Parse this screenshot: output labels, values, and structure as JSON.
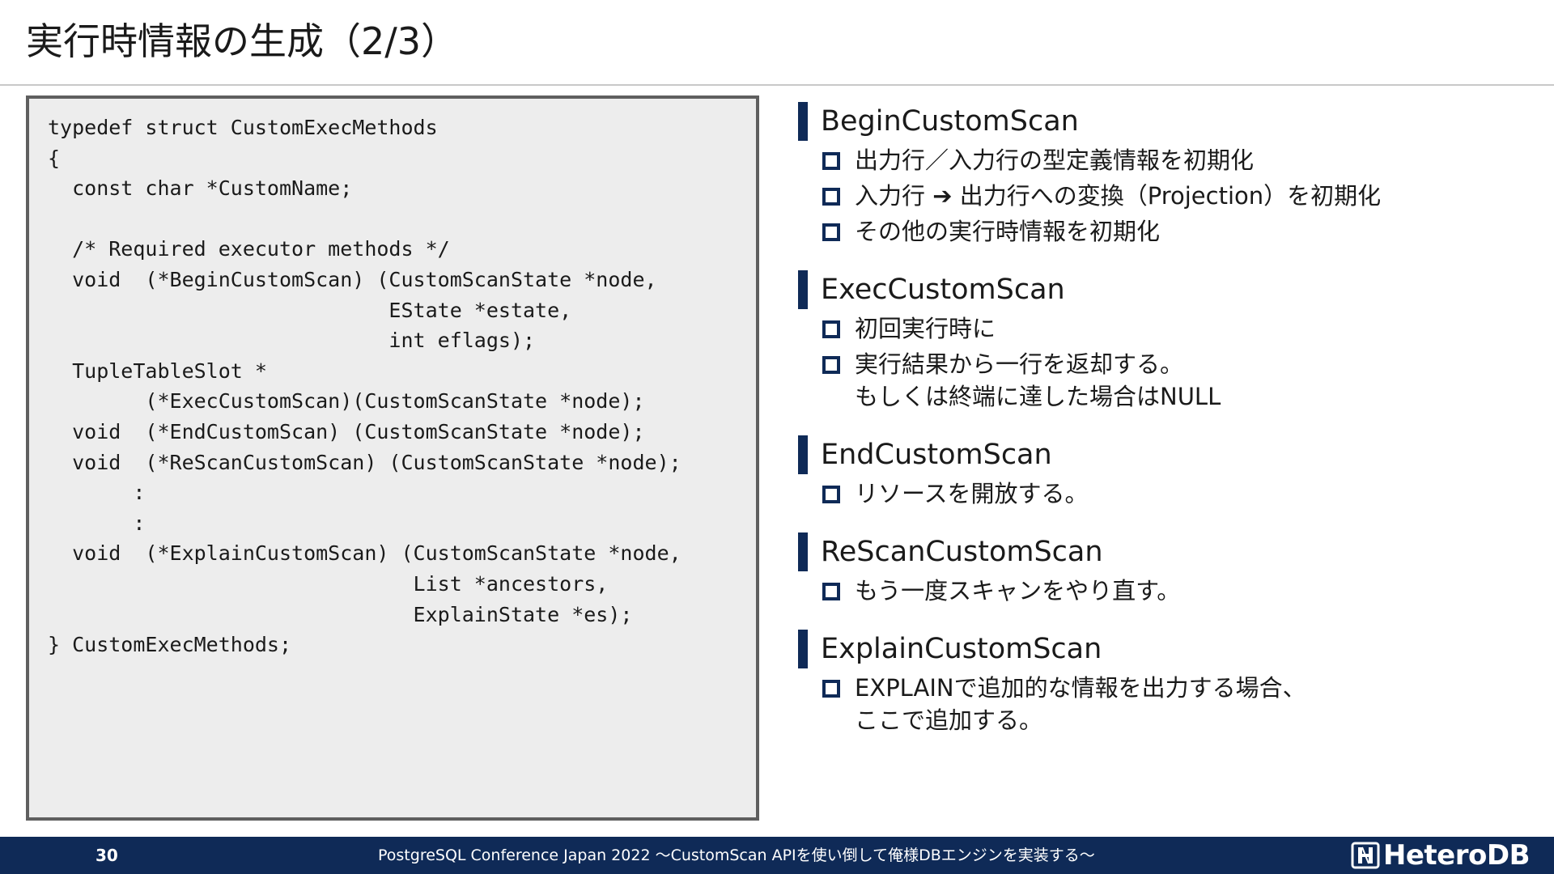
{
  "title": "実行時情報の生成（2/3）",
  "code": "typedef struct CustomExecMethods\n{\n  const char *CustomName;\n\n  /* Required executor methods */\n  void  (*BeginCustomScan) (CustomScanState *node,\n                            EState *estate,\n                            int eflags);\n  TupleTableSlot *\n        (*ExecCustomScan)(CustomScanState *node);\n  void  (*EndCustomScan) (CustomScanState *node);\n  void  (*ReScanCustomScan) (CustomScanState *node);\n       :\n       :\n  void  (*ExplainCustomScan) (CustomScanState *node,\n                              List *ancestors,\n                              ExplainState *es);\n} CustomExecMethods;",
  "sections": [
    {
      "title": "BeginCustomScan",
      "items": [
        "出力行／入力行の型定義情報を初期化",
        "入力行 ➔ 出力行への変換（Projection）を初期化",
        "その他の実行時情報を初期化"
      ]
    },
    {
      "title": "ExecCustomScan",
      "items": [
        "初回実行時に",
        "実行結果から一行を返却する。\nもしくは終端に達した場合はNULL"
      ]
    },
    {
      "title": "EndCustomScan",
      "items": [
        "リソースを開放する。"
      ]
    },
    {
      "title": "ReScanCustomScan",
      "items": [
        "もう一度スキャンをやり直す。"
      ]
    },
    {
      "title": "ExplainCustomScan",
      "items": [
        "EXPLAINで追加的な情報を出力する場合、\nここで追加する。"
      ]
    }
  ],
  "footer": {
    "page_number": "30",
    "text": "PostgreSQL Conference Japan 2022 ～CustomScan APIを使い倒して俺様DBエンジンを実装する～",
    "logo_text": "HeteroDB",
    "logo_icon": "heterodb-logo-icon"
  },
  "colors": {
    "accent": "#0f2a57",
    "code_background": "#ededed",
    "code_border": "#5f5f5f"
  }
}
